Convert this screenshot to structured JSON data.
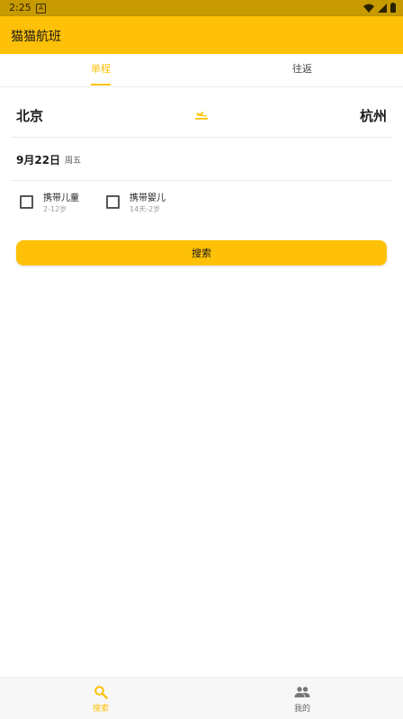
{
  "status_bar": {
    "time": "2:25",
    "notif_glyph": "A"
  },
  "app": {
    "title": "猫猫航班"
  },
  "tabs": [
    {
      "label": "单程",
      "active": true
    },
    {
      "label": "往返",
      "active": false
    }
  ],
  "route": {
    "from": "北京",
    "to": "杭州",
    "swap_icon": "flight-swap-icon"
  },
  "date": {
    "date": "9月22日",
    "weekday": "周五"
  },
  "options": [
    {
      "label": "携带儿童",
      "sub": "2-12岁",
      "checked": false
    },
    {
      "label": "携带婴儿",
      "sub": "14天-2岁",
      "checked": false
    }
  ],
  "search_button": {
    "label": "搜索"
  },
  "bottom_nav": [
    {
      "label": "搜索",
      "icon": "search-icon",
      "active": true
    },
    {
      "label": "我的",
      "icon": "people-icon",
      "active": false
    }
  ],
  "colors": {
    "accent": "#ffc107",
    "status_bar": "#c79a00"
  }
}
